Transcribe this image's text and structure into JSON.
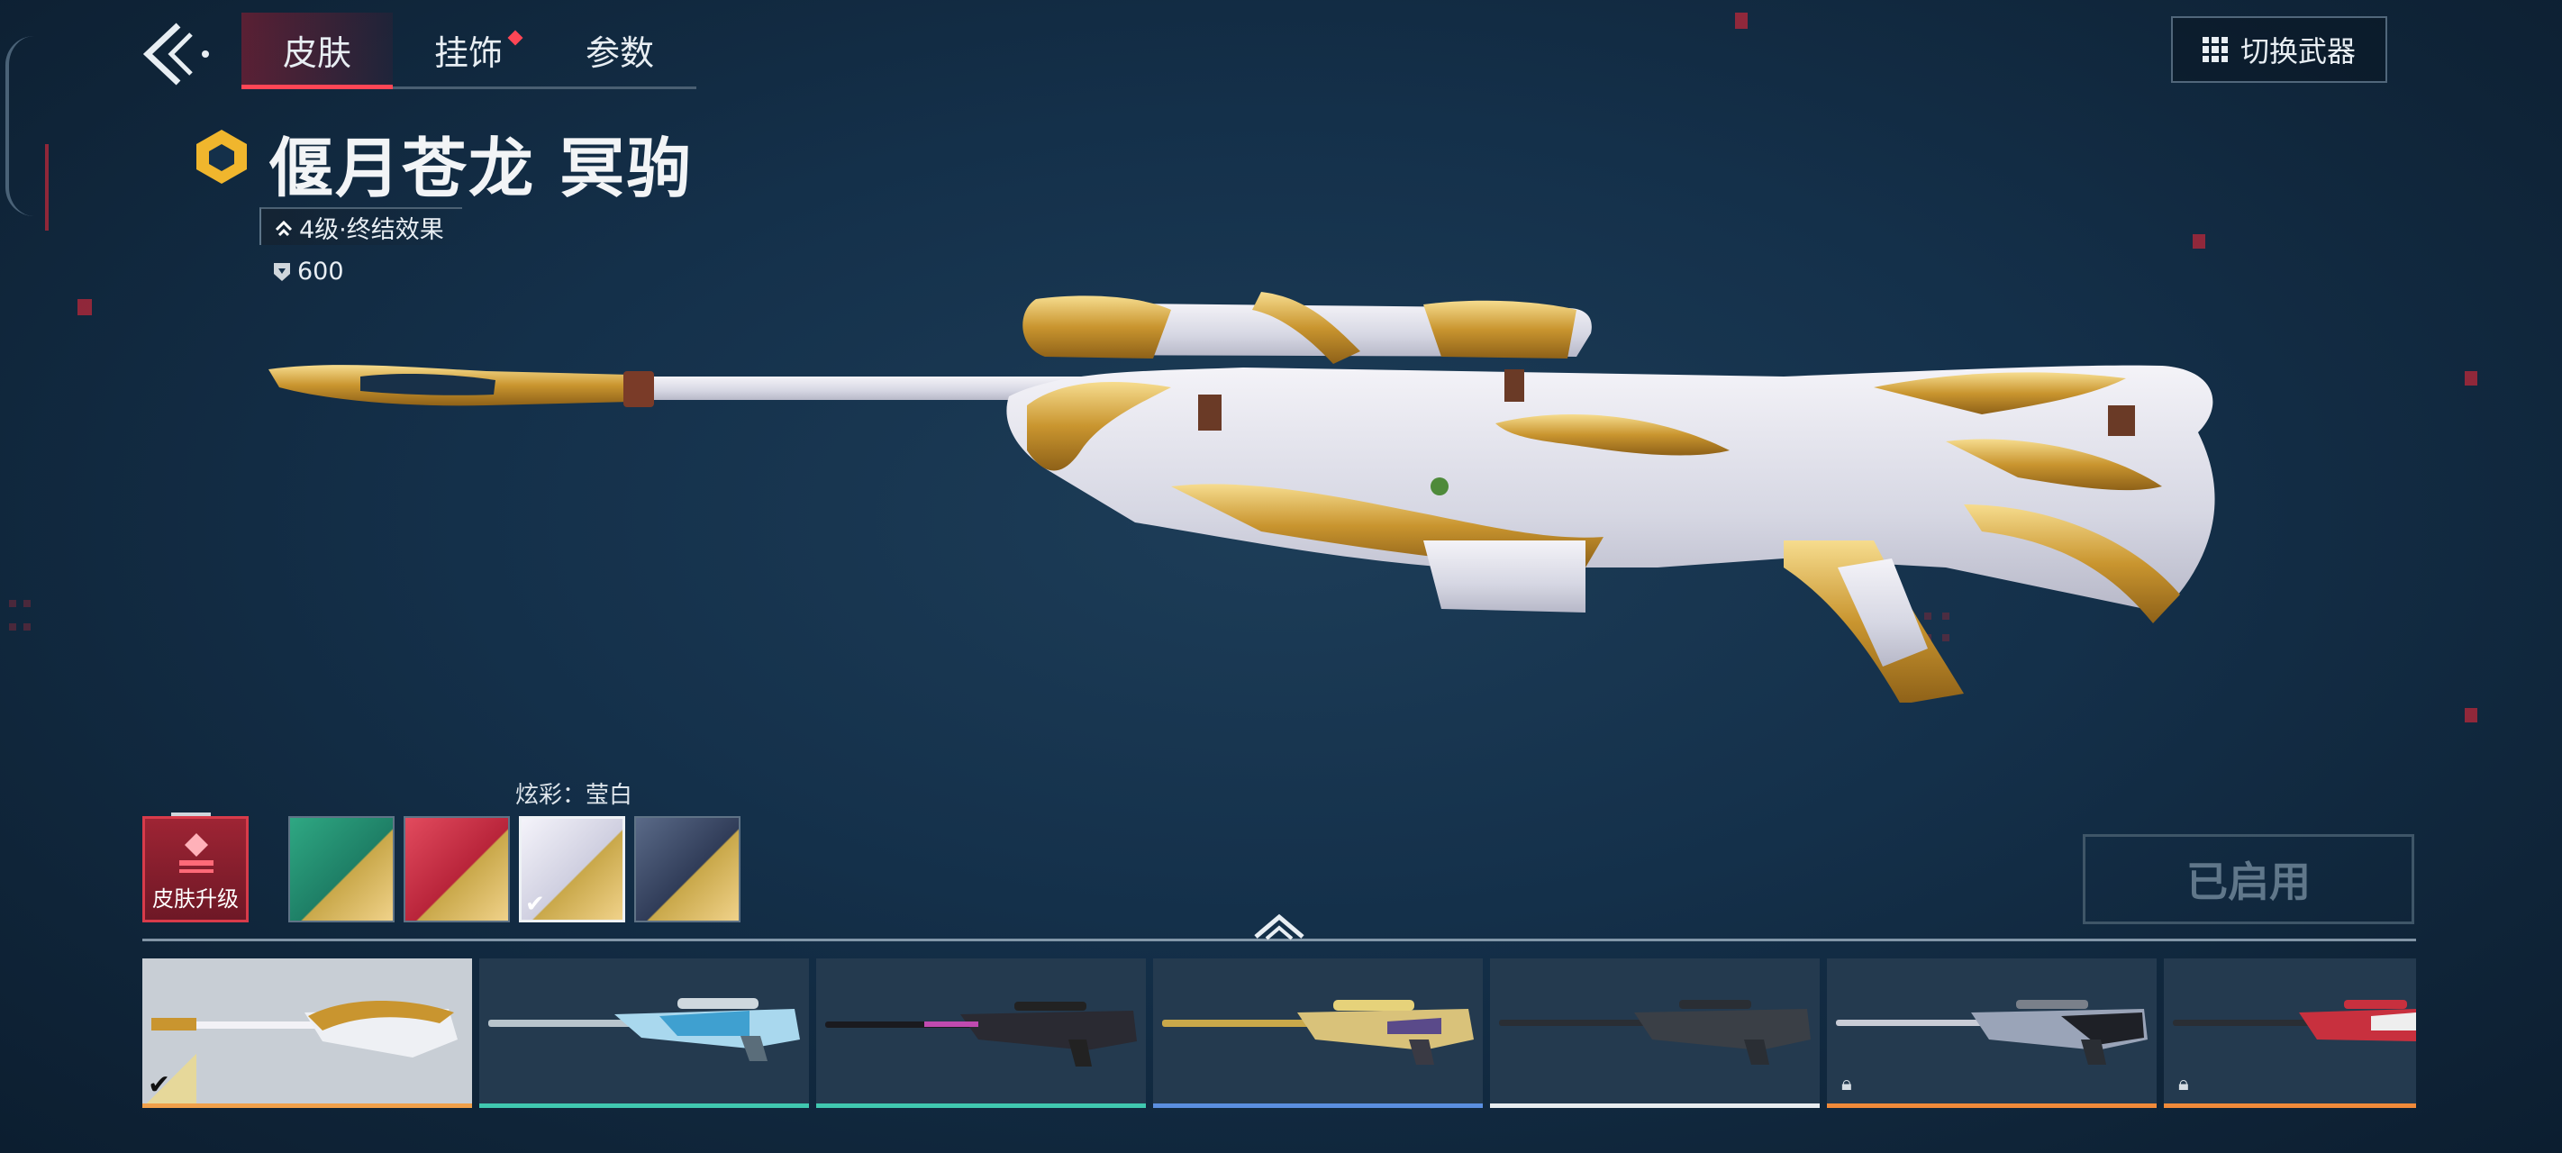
{
  "header": {
    "tabs": [
      {
        "label": "皮肤",
        "active": true
      },
      {
        "label": "挂饰",
        "active": false,
        "has_notification": true
      },
      {
        "label": "参数",
        "active": false
      }
    ],
    "switch_weapon_label": "切换武器"
  },
  "skin": {
    "name": "偃月苍龙 冥驹",
    "level_text": "4级·终结效果",
    "price": "600"
  },
  "upgrade_button_label": "皮肤升级",
  "variants": {
    "current_label": "炫彩：莹白",
    "swatches": [
      {
        "name": "green",
        "color": "#2fa883",
        "selected": false
      },
      {
        "name": "red",
        "color": "#d4354a",
        "selected": false
      },
      {
        "name": "white",
        "color": "#e9e8f2",
        "selected": true
      },
      {
        "name": "navy",
        "color": "#3c4a6a",
        "selected": false
      }
    ]
  },
  "enabled_label": "已启用",
  "colors": {
    "accent_red": "#ff4655",
    "gold": "#d6a94a"
  },
  "weapon_list": [
    {
      "selected": true,
      "locked": false,
      "bar_color": "#f0a04a"
    },
    {
      "selected": false,
      "locked": false,
      "bar_color": "#40c8b0"
    },
    {
      "selected": false,
      "locked": false,
      "bar_color": "#40c8b0"
    },
    {
      "selected": false,
      "locked": false,
      "bar_color": "#5b8fe0"
    },
    {
      "selected": false,
      "locked": false,
      "bar_color": "#e8ecef"
    },
    {
      "selected": false,
      "locked": true,
      "bar_color": "#f08a3a"
    },
    {
      "selected": false,
      "locked": true,
      "bar_color": "#f08a3a"
    }
  ]
}
